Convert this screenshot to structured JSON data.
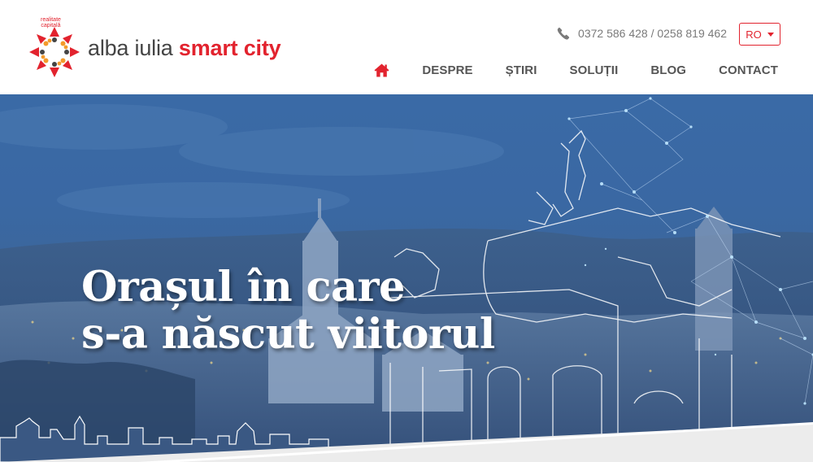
{
  "header": {
    "logo": {
      "tagline_line1": "realitate",
      "tagline_line2": "capitală",
      "name_plain": "alba iulia ",
      "name_accent": "smart city"
    },
    "phone": {
      "icon": "phone-icon",
      "text": "0372 586 428 / 0258 819 462"
    },
    "language": {
      "selected": "RO"
    },
    "nav": {
      "home_icon": "home-icon",
      "items": [
        "DESPRE",
        "ȘTIRI",
        "SOLUȚII",
        "BLOG",
        "CONTACT"
      ]
    }
  },
  "hero": {
    "title_line1": "Orașul în care",
    "title_line2": "s-a născut viitorul"
  },
  "colors": {
    "brand_red": "#e2232e",
    "brand_orange": "#f39a2b",
    "nav_text": "#555555",
    "hero_blue": "#3a6aa6"
  }
}
